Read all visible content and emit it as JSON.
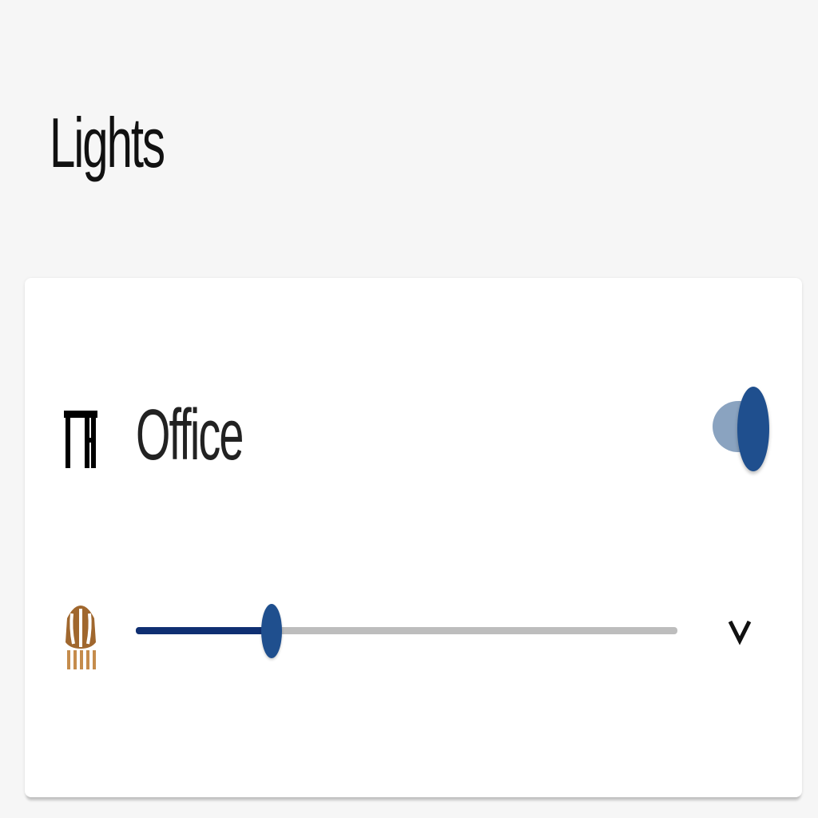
{
  "section": {
    "title": "Lights"
  },
  "card": {
    "device": {
      "name": "Office",
      "icon": "desk-lamp-icon",
      "power_on": true
    },
    "brightness": {
      "icon": "bulb-icon",
      "fraction": 0.25
    },
    "expand_icon": "chevron-down-icon"
  },
  "colors": {
    "accent": "#1f4f8e",
    "slider_fill": "#0f2f72",
    "toggle_track": "#8aa3c0",
    "bulb": "#a0672e"
  }
}
